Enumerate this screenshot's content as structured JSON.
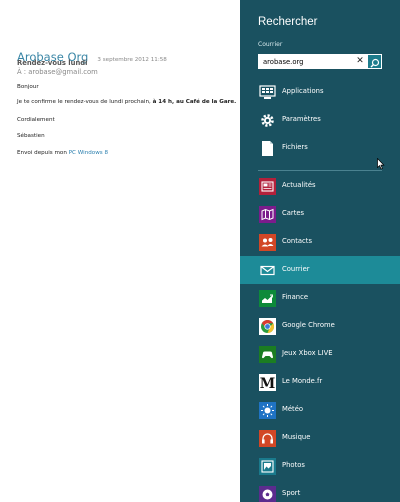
{
  "mail": {
    "sender": "Arobase Org",
    "date": "3 septembre 2012    11:58",
    "subject": "Rendez-vous lundi",
    "to": "À : arobase@gmail.com",
    "greeting": "Bonjour",
    "body_prefix": "Je te confirme le rendez-vous de lundi prochain, ",
    "body_bold": "à 14 h, au Café de la Gare.",
    "closing": "Cordialement",
    "signature": "Sébastien",
    "sent_from_prefix": "Envoi depuis mon ",
    "sent_from_link": "PC Windows 8"
  },
  "search": {
    "title": "Rechercher",
    "scope": "Courrier",
    "query": "arobase.org",
    "clear_glyph": "✕"
  },
  "system_items": [
    {
      "label": "Applications",
      "icon": "applications-icon",
      "color": "#1a5160"
    },
    {
      "label": "Paramètres",
      "icon": "settings-gear-icon",
      "color": "#1a5160"
    },
    {
      "label": "Fichiers",
      "icon": "files-icon",
      "color": "#1a5160"
    }
  ],
  "apps": [
    {
      "label": "Actualités",
      "icon": "news-icon",
      "color": "#b3213b"
    },
    {
      "label": "Cartes",
      "icon": "maps-icon",
      "color": "#7b1c8c"
    },
    {
      "label": "Contacts",
      "icon": "contacts-icon",
      "color": "#d24726"
    },
    {
      "label": "Courrier",
      "icon": "mail-icon",
      "color": "#1d8b98",
      "selected": true
    },
    {
      "label": "Finance",
      "icon": "finance-icon",
      "color": "#0d8a3a"
    },
    {
      "label": "Google Chrome",
      "icon": "chrome-icon",
      "color": "#ffffff"
    },
    {
      "label": "Jeux Xbox LIVE",
      "icon": "xbox-games-icon",
      "color": "#1b7d22"
    },
    {
      "label": "Le Monde.fr",
      "icon": "le-monde-icon",
      "color": "#ffffff"
    },
    {
      "label": "Météo",
      "icon": "weather-icon",
      "color": "#1f73c4"
    },
    {
      "label": "Musique",
      "icon": "music-icon",
      "color": "#d24726"
    },
    {
      "label": "Photos",
      "icon": "photos-icon",
      "color": "#1a7a8c"
    },
    {
      "label": "Sport",
      "icon": "sport-icon",
      "color": "#5b2c8e"
    }
  ]
}
